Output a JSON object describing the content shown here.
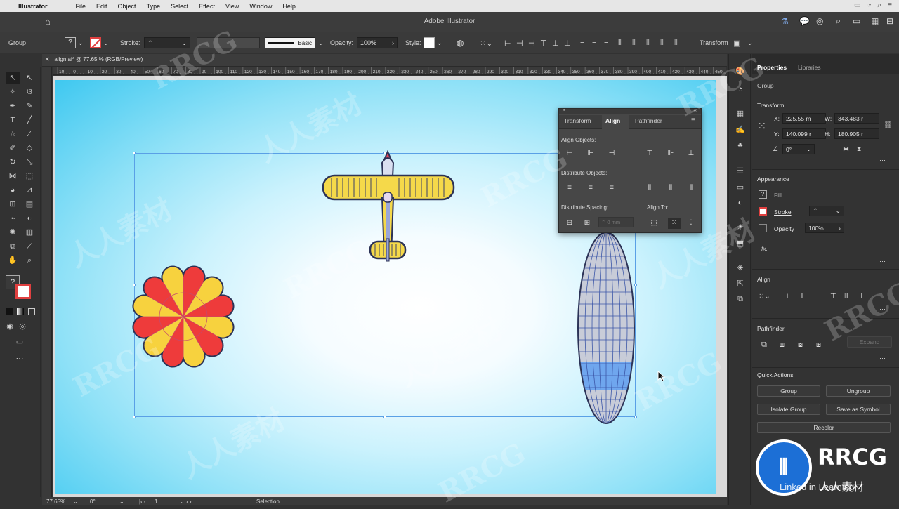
{
  "menubar": {
    "app": "Illustrator",
    "items": [
      "File",
      "Edit",
      "Object",
      "Type",
      "Select",
      "Effect",
      "View",
      "Window",
      "Help"
    ]
  },
  "titlebar": {
    "title": "Adobe Illustrator"
  },
  "controlbar": {
    "selection_type": "Group",
    "stroke_label": "Stroke:",
    "brush_label": "Basic",
    "opacity_label": "Opacity:",
    "opacity_value": "100%",
    "style_label": "Style:",
    "transform_label": "Transform"
  },
  "document": {
    "tab_title": "align.ai* @ 77.65 % (RGB/Preview)"
  },
  "ruler": {
    "ticks": [
      "10",
      "0",
      "10",
      "20",
      "30",
      "40",
      "50",
      "60",
      "70",
      "80",
      "90",
      "100",
      "110",
      "120",
      "130",
      "140",
      "150",
      "160",
      "170",
      "180",
      "190",
      "200",
      "210",
      "220",
      "230",
      "240",
      "250",
      "260",
      "270",
      "280",
      "290",
      "300",
      "310",
      "320",
      "330",
      "340",
      "350",
      "360",
      "370",
      "380",
      "390",
      "400",
      "410",
      "420",
      "430",
      "440",
      "450"
    ]
  },
  "statusbar": {
    "zoom": "77.65%",
    "rotation": "0°",
    "artboard_num": "1",
    "tool": "Selection"
  },
  "align_panel": {
    "tabs": [
      "Transform",
      "Align",
      "Pathfinder"
    ],
    "active_tab": "Align",
    "align_objects": "Align Objects:",
    "distribute_objects": "Distribute Objects:",
    "distribute_spacing": "Distribute Spacing:",
    "align_to": "Align To:",
    "spacing_value": "0 mm"
  },
  "properties": {
    "tabs": [
      "Properties",
      "Libraries"
    ],
    "active_tab": "Properties",
    "object_type": "Group",
    "transform_title": "Transform",
    "x_label": "X:",
    "x_value": "225.55 m",
    "y_label": "Y:",
    "y_value": "140.099 r",
    "w_label": "W:",
    "w_value": "343.483 r",
    "h_label": "H:",
    "h_value": "180.905 r",
    "angle_value": "0°",
    "appearance_title": "Appearance",
    "fill_label": "Fill",
    "stroke_label": "Stroke",
    "opacity_label": "Opacity",
    "opacity_value": "100%",
    "fx_label": "fx.",
    "align_title": "Align",
    "pathfinder_title": "Pathfinder",
    "expand_label": "Expand",
    "quick_actions_title": "Quick Actions",
    "buttons": {
      "group": "Group",
      "ungroup": "Ungroup",
      "isolate": "Isolate Group",
      "save_symbol": "Save as Symbol",
      "recolor": "Recolor"
    }
  },
  "watermark": {
    "text_latin": "RRCG",
    "text_cn": "人人素材",
    "logo_text": "RRCG",
    "logo_sub": "人人素材",
    "linkedin": "Linked in Learning"
  },
  "colors": {
    "accent_blue": "#5aa0e6",
    "parachute_red": "#ee3b3b",
    "parachute_yellow": "#f7d23e",
    "plane_yellow": "#f5d94a",
    "blimp_gray": "#c8ccd8",
    "blimp_band": "#6fa6ee"
  }
}
